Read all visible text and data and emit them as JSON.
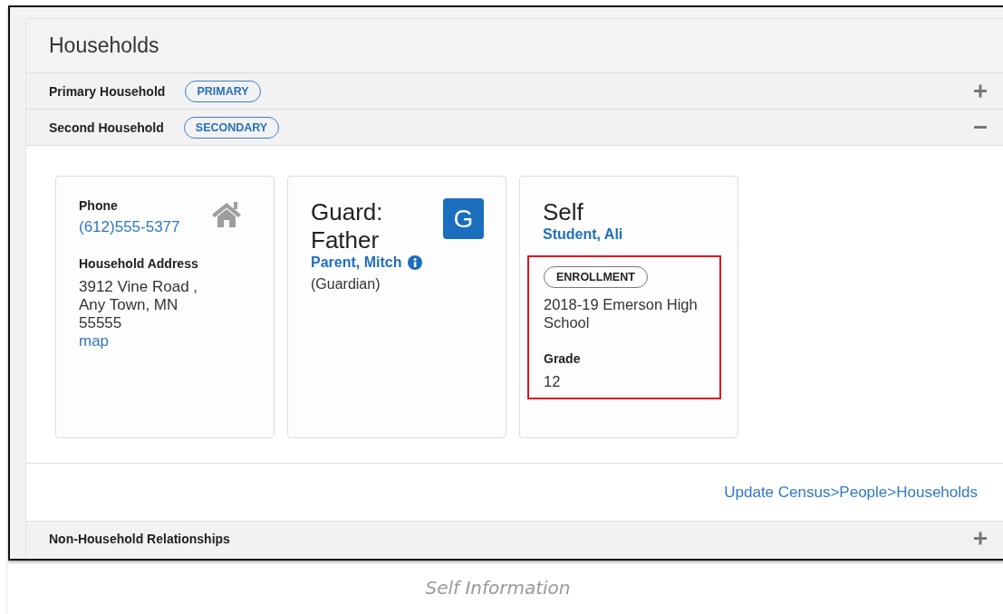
{
  "panel": {
    "title": "Households"
  },
  "households": [
    {
      "name": "Primary Household",
      "badge": "PRIMARY",
      "expanded": false
    },
    {
      "name": "Second Household",
      "badge": "SECONDARY",
      "expanded": true
    }
  ],
  "cards": [
    {
      "kind": "contact",
      "phone_label": "Phone",
      "phone": "(612)555-5377",
      "address_label": "Household Address",
      "address_lines": [
        "3912 Vine Road ,",
        "Any Town, MN",
        "55555"
      ],
      "map_link": "map"
    },
    {
      "kind": "guardian",
      "title_lines": [
        "Guard:",
        "Father"
      ],
      "avatar_letter": "G",
      "person": "Parent, Mitch",
      "role": "(Guardian)"
    },
    {
      "kind": "self",
      "title": "Self",
      "person": "Student, Ali",
      "highlighted": true,
      "badge": "ENROLLMENT",
      "enrollment": "2018-19 Emerson High School",
      "grade_label": "Grade",
      "grade": "12"
    }
  ],
  "update_link": "Update Census>People>Households",
  "non_household": {
    "name": "Non-Household Relationships",
    "expanded": false
  },
  "caption": "Self Information"
}
